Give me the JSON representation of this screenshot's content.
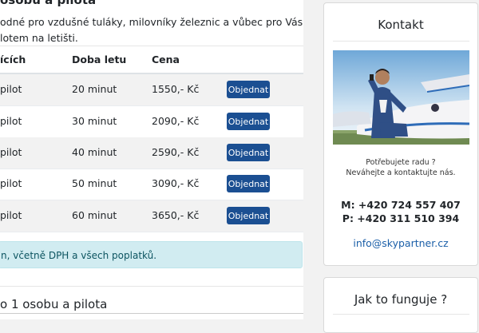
{
  "main": {
    "heading": "osobu a pilota",
    "intro_line1": "odné pro vzdušné tuláky, milovníky železnic a vůbec pro Vás, kteří se rádi",
    "intro_line2": "lotem na letišti.",
    "table": {
      "headers": [
        "ících",
        "Doba letu",
        "Cena"
      ],
      "rows": [
        {
          "who": "pilot",
          "duration": "20 minut",
          "price": "1550,- Kč",
          "action": "Objednat"
        },
        {
          "who": "pilot",
          "duration": "30 minut",
          "price": "2090,- Kč",
          "action": "Objednat"
        },
        {
          "who": "pilot",
          "duration": "40 minut",
          "price": "2590,- Kč",
          "action": "Objednat"
        },
        {
          "who": "pilot",
          "duration": "50 minut",
          "price": "3090,- Kč",
          "action": "Objednat"
        },
        {
          "who": "pilot",
          "duration": "60 minut",
          "price": "3650,- Kč",
          "action": "Objednat"
        }
      ]
    },
    "note": "n, včetně DPH a všech poplatků.",
    "section_heading": "o 1 osobu a pilota"
  },
  "sidebar": {
    "contact": {
      "title": "Kontakt",
      "text1": "Potřebujete radu ?",
      "text2": "Neváhejte a kontaktujte nás.",
      "phone1": "M: +420 724 557 407",
      "phone2": "P: +420 311 510 394",
      "email": "info@skypartner.cz"
    },
    "how": {
      "title": "Jak to funguje ?"
    }
  },
  "colors": {
    "button": "#1b4f92",
    "alert_bg": "#d1ecf1",
    "link": "#1b5fa8"
  }
}
